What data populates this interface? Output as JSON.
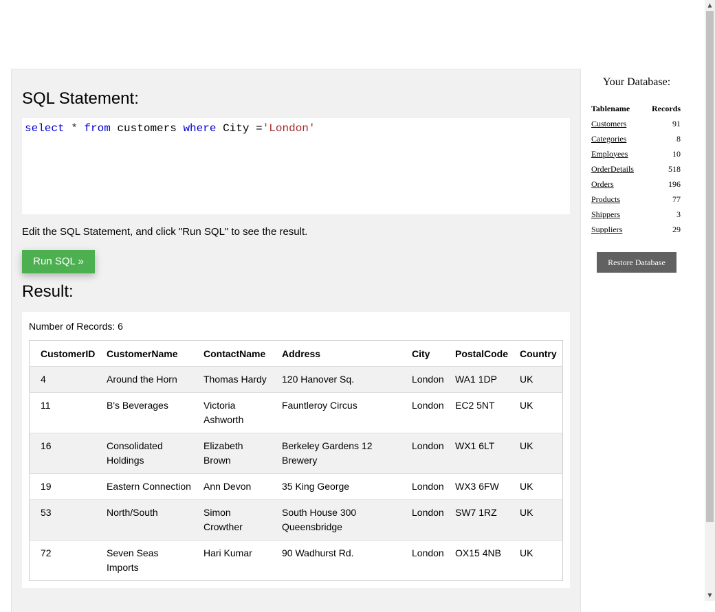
{
  "editor": {
    "heading": "SQL Statement:",
    "code": [
      {
        "text": "select",
        "cls": "kw"
      },
      {
        "text": " * ",
        "cls": "op"
      },
      {
        "text": "from",
        "cls": "kw"
      },
      {
        "text": " customers ",
        "cls": "ident"
      },
      {
        "text": "where",
        "cls": "kw"
      },
      {
        "text": " City =",
        "cls": "ident"
      },
      {
        "text": "'London'",
        "cls": "str"
      }
    ],
    "hint": "Edit the SQL Statement, and click \"Run SQL\" to see the result.",
    "run_label": "Run SQL »"
  },
  "result": {
    "heading": "Result:",
    "count_text": "Number of Records: 6",
    "columns": [
      "CustomerID",
      "CustomerName",
      "ContactName",
      "Address",
      "City",
      "PostalCode",
      "Country"
    ],
    "rows": [
      [
        "4",
        "Around the Horn",
        "Thomas Hardy",
        "120 Hanover Sq.",
        "London",
        "WA1 1DP",
        "UK"
      ],
      [
        "11",
        "B's Beverages",
        "Victoria Ashworth",
        "Fauntleroy Circus",
        "London",
        "EC2 5NT",
        "UK"
      ],
      [
        "16",
        "Consolidated Holdings",
        "Elizabeth Brown",
        "Berkeley Gardens 12 Brewery",
        "London",
        "WX1 6LT",
        "UK"
      ],
      [
        "19",
        "Eastern Connection",
        "Ann Devon",
        "35 King George",
        "London",
        "WX3 6FW",
        "UK"
      ],
      [
        "53",
        "North/South",
        "Simon Crowther",
        "South House 300 Queensbridge",
        "London",
        "SW7 1RZ",
        "UK"
      ],
      [
        "72",
        "Seven Seas Imports",
        "Hari Kumar",
        "90 Wadhurst Rd.",
        "London",
        "OX15 4NB",
        "UK"
      ]
    ]
  },
  "database": {
    "title": "Your Database:",
    "col_table": "Tablename",
    "col_records": "Records",
    "tables": [
      {
        "name": "Customers",
        "records": "91"
      },
      {
        "name": "Categories",
        "records": "8"
      },
      {
        "name": "Employees",
        "records": "10"
      },
      {
        "name": "OrderDetails",
        "records": "518"
      },
      {
        "name": "Orders",
        "records": "196"
      },
      {
        "name": "Products",
        "records": "77"
      },
      {
        "name": "Shippers",
        "records": "3"
      },
      {
        "name": "Suppliers",
        "records": "29"
      }
    ],
    "restore_label": "Restore Database"
  },
  "scrollbar": {
    "up_icon": "▲",
    "down_icon": "▼"
  },
  "colors": {
    "run_button": "#4caf50",
    "restore_button": "#616161",
    "keyword": "#0000cd",
    "string": "#a52a2a"
  }
}
